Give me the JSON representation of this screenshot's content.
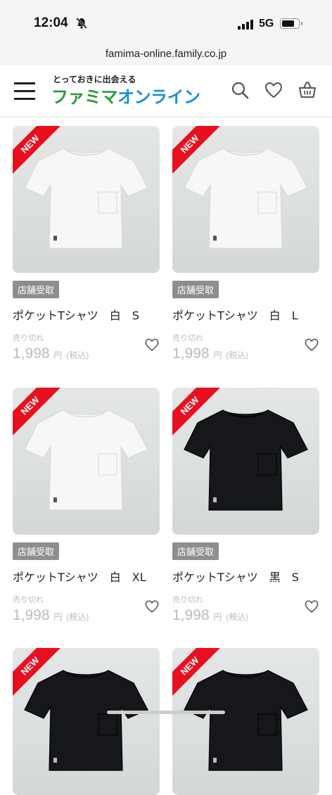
{
  "status": {
    "time": "12:04",
    "network": "5G"
  },
  "browser": {
    "url": "famima-online.family.co.jp"
  },
  "header": {
    "tagline": "とっておきに出会える",
    "logo_part1": "ファミマ",
    "logo_part2": "オンライン"
  },
  "products": [
    {
      "badge": "NEW",
      "pickup": "店舗受取",
      "name": "ポケットTシャツ　白　S",
      "status": "売り切れ",
      "price": "1,998",
      "currency": "円",
      "tax": "(税込)",
      "color": "white"
    },
    {
      "badge": "NEW",
      "pickup": "店舗受取",
      "name": "ポケットTシャツ　白　L",
      "status": "売り切れ",
      "price": "1,998",
      "currency": "円",
      "tax": "(税込)",
      "color": "white"
    },
    {
      "badge": "NEW",
      "pickup": "店舗受取",
      "name": "ポケットTシャツ　白　XL",
      "status": "売り切れ",
      "price": "1,998",
      "currency": "円",
      "tax": "(税込)",
      "color": "white"
    },
    {
      "badge": "NEW",
      "pickup": "店舗受取",
      "name": "ポケットTシャツ　黒　S",
      "status": "売り切れ",
      "price": "1,998",
      "currency": "円",
      "tax": "(税込)",
      "color": "black"
    },
    {
      "badge": "NEW",
      "color": "black"
    },
    {
      "badge": "NEW",
      "color": "black"
    }
  ]
}
